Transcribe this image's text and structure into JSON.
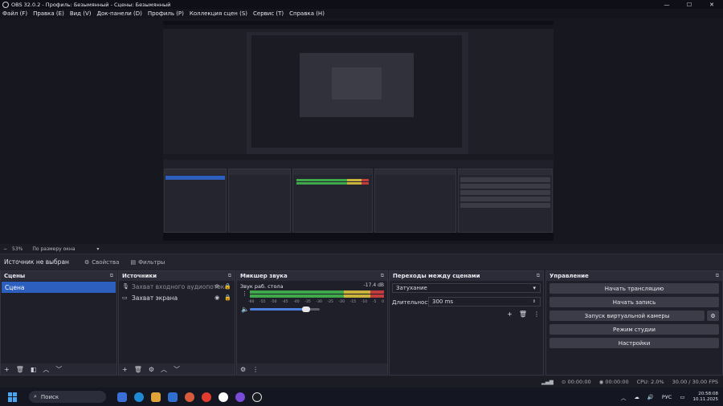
{
  "window": {
    "title": "OBS 32.0.2 - Профиль: Безымянный - Сцены: Безымянный",
    "minimize": "—",
    "maximize": "☐",
    "close": "✕"
  },
  "menu": {
    "items": [
      "Файл (F)",
      "Правка (E)",
      "Вид (V)",
      "Док-панели (D)",
      "Профиль (P)",
      "Коллекция сцен (S)",
      "Сервис (T)",
      "Справка (H)"
    ]
  },
  "preview_status": {
    "zoom": "53%",
    "fit": "По размеру окна"
  },
  "source_toolbar": {
    "no_source": "Источник не выбран",
    "properties": "Свойства",
    "filters": "Фильтры"
  },
  "scenes": {
    "title": "Сцены",
    "items": [
      "Сцена"
    ]
  },
  "sources": {
    "title": "Источники",
    "items": [
      {
        "label": "Захват входного аудиопотока",
        "icon": "microphone-icon"
      },
      {
        "label": "Захват экрана",
        "icon": "monitor-icon"
      }
    ]
  },
  "mixer": {
    "title": "Микшер звука",
    "channel_name": "Звук раб. стола",
    "db_value": "-17.4 dB",
    "volume_fraction": 0.8,
    "ticks": [
      "-60",
      "-55",
      "-50",
      "-45",
      "-40",
      "-35",
      "-30",
      "-25",
      "-20",
      "-15",
      "-10",
      "-5",
      "0"
    ]
  },
  "transitions": {
    "title": "Переходы между сценами",
    "type": "Затухание",
    "duration_label": "Длительность",
    "duration_value": "300 ms"
  },
  "controls": {
    "title": "Управление",
    "start_stream": "Начать трансляцию",
    "start_record": "Начать запись",
    "virtual_cam": "Запуск виртуальной камеры",
    "studio_mode": "Режим студии",
    "settings": "Настройки"
  },
  "status": {
    "stream_time": "00:00:00",
    "rec_time": "00:00:00",
    "cpu": "CPU: 2.0%",
    "fps": "30.00 / 30.00 FPS"
  },
  "taskbar": {
    "search": "Поиск",
    "lang": "РУС",
    "time": "20:58:08",
    "date": "10.11.2025"
  },
  "colors": {
    "accent": "#2d5fbf",
    "meter_green": "#3fa84a",
    "meter_yellow": "#c9b33a",
    "meter_red": "#c43b3b"
  }
}
